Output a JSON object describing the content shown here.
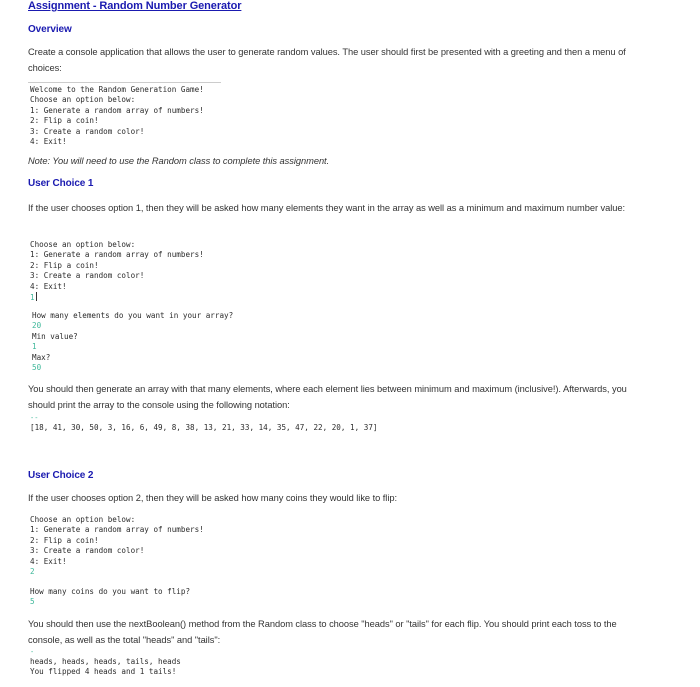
{
  "title": "Assignment - Random Number Generator",
  "overview": {
    "heading": "Overview",
    "text": "Create a console application that allows the user to generate random values.  The user should first be presented with a greeting and then a menu of choices:",
    "console_lines": [
      "Welcome to the Random Generation Game!",
      "Choose an option below:",
      "1: Generate a random array of numbers!",
      "2: Flip a coin!",
      "3: Create a random color!",
      "4: Exit!"
    ],
    "note": "Note: You will need to use the Random class to complete this assignment."
  },
  "choice1": {
    "heading": "User Choice 1",
    "text": "If the user chooses option 1, then they will be asked how many elements they want in the array as well as a minimum and maximum number value:",
    "menu_lines": [
      "Choose an option below:",
      "1: Generate a random array of numbers!",
      "2: Flip a coin!",
      "3: Create a random color!",
      "4: Exit!"
    ],
    "menu_input": "1",
    "prompt_elements": "How many elements do you want in your array?",
    "input_elements": "20",
    "prompt_min": "Min value?",
    "input_min": "1",
    "prompt_max": "Max?",
    "input_max": "50",
    "text2": "You should then generate an array with that many elements, where each element lies between minimum and maximum (inclusive!). Afterwards, you should print the array to the console using the following notation:",
    "dash": "--",
    "array_output": "[18, 41, 30, 50, 3, 16, 6, 49, 8, 38, 13, 21, 33, 14, 35, 47, 22, 20, 1, 37]"
  },
  "choice2": {
    "heading": "User Choice 2",
    "text": "If the user chooses option 2, then they will be asked how many coins they would like to flip:",
    "menu_lines": [
      "Choose an option below:",
      "1: Generate a random array of numbers!",
      "2: Flip a coin!",
      "3: Create a random color!",
      "4: Exit!"
    ],
    "menu_input": "2",
    "prompt_coins": "How many coins do you want to flip?",
    "input_coins": "5",
    "text2": "You should then use the nextBoolean() method from the Random class to choose \"heads\" or \"tails\" for each flip. You should print each toss to the console, as well as the total \"heads\" and \"tails\":",
    "dash": "-",
    "flips_output": "heads, heads, heads, tails, heads",
    "summary_output": "You flipped 4 heads and 1 tails!"
  }
}
